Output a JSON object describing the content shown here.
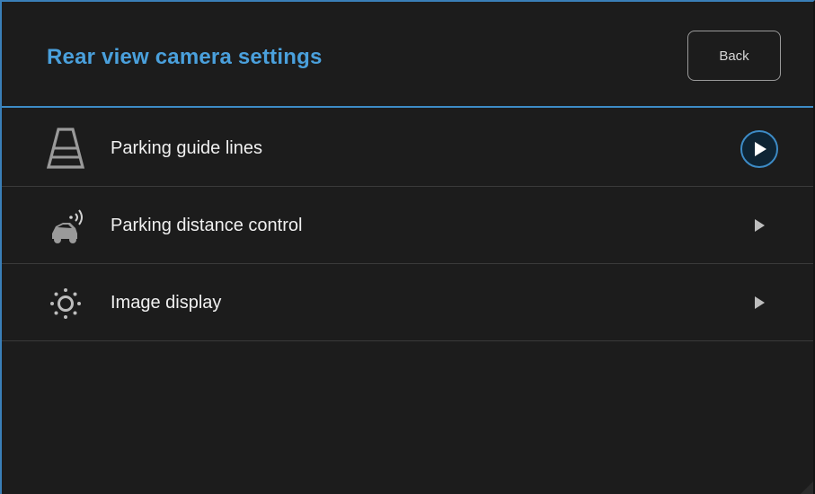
{
  "header": {
    "title": "Rear view camera settings",
    "back_label": "Back"
  },
  "menu": [
    {
      "label": "Parking guide lines",
      "icon": "parking-guide-lines-icon",
      "selected": true
    },
    {
      "label": "Parking distance control",
      "icon": "parking-distance-control-icon",
      "selected": false
    },
    {
      "label": "Image display",
      "icon": "image-display-brightness-icon",
      "selected": false
    }
  ],
  "colors": {
    "accent": "#4aa0dc",
    "background": "#1c1c1c",
    "divider": "#3a3a3a",
    "text": "#f0f0f0",
    "icon": "#9a9a9a"
  }
}
